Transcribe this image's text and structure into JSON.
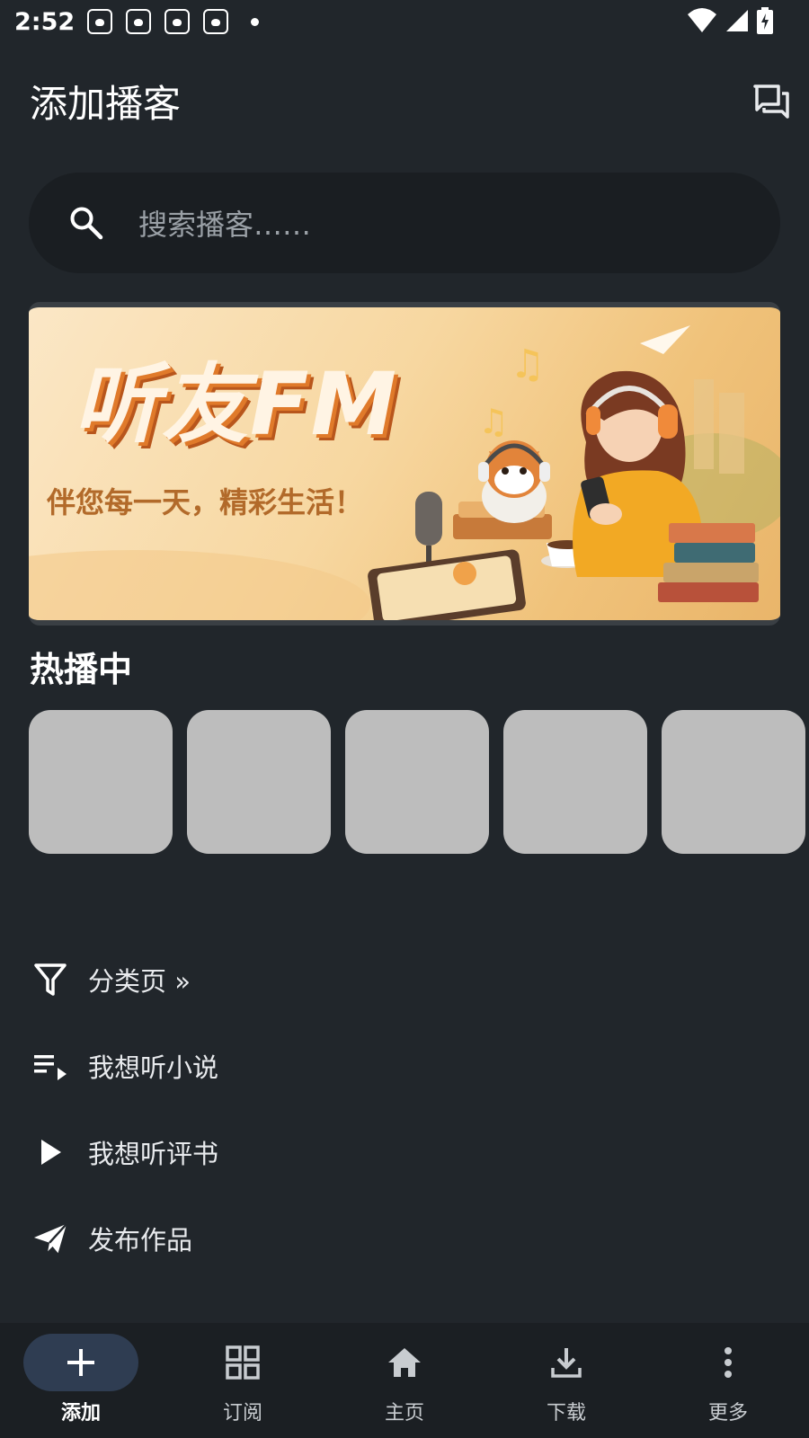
{
  "status_bar": {
    "time": "2:52",
    "notification_icons": [
      "paw-icon",
      "paw-icon",
      "paw-icon",
      "paw-icon"
    ],
    "right_icons": [
      "wifi-icon",
      "signal-icon",
      "battery-charging-icon"
    ]
  },
  "app_bar": {
    "title": "添加播客",
    "action_icon": "feedback-icon"
  },
  "search": {
    "placeholder": "搜索播客……"
  },
  "banner": {
    "title": "听友FM",
    "subtitle": "伴您每一天，精彩生活！"
  },
  "hot": {
    "title": "热播中",
    "cards": [
      "",
      "",
      "",
      "",
      ""
    ]
  },
  "menu": {
    "items": [
      {
        "label": "分类页 »",
        "icon": "filter-icon"
      },
      {
        "label": "我想听小说",
        "icon": "playlist-play-icon"
      },
      {
        "label": "我想听评书",
        "icon": "play-icon"
      },
      {
        "label": "发布作品",
        "icon": "send-icon"
      }
    ]
  },
  "bottom_nav": {
    "items": [
      {
        "label": "添加",
        "icon": "add-icon",
        "active": true
      },
      {
        "label": "订阅",
        "icon": "grid-icon",
        "active": false
      },
      {
        "label": "主页",
        "icon": "home-icon",
        "active": false
      },
      {
        "label": "下载",
        "icon": "download-icon",
        "active": false
      },
      {
        "label": "更多",
        "icon": "more-vert-icon",
        "active": false
      }
    ]
  },
  "colors": {
    "background": "#21262b",
    "search_background": "#1a1e22",
    "card_placeholder": "#bdbdbd",
    "nav_active_pill": "#2f3d52"
  }
}
